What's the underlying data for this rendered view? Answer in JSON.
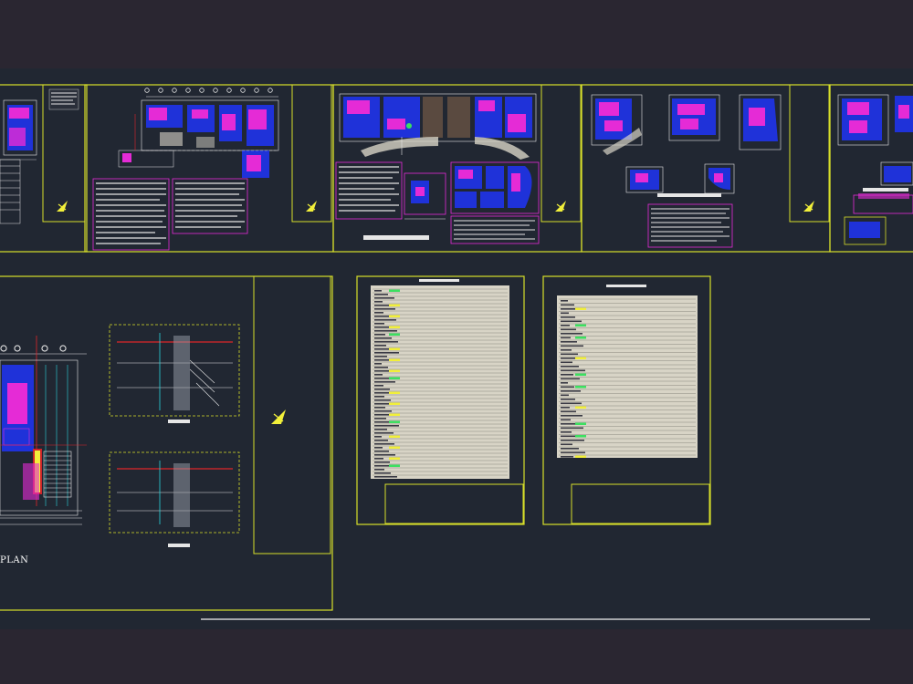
{
  "colors": {
    "bar": "#2a2631",
    "canvas": "#212732",
    "frame": "#d8df2a",
    "magenta": "#e52bd6",
    "blue": "#1f32d9",
    "cyan": "#2ad6dd",
    "red": "#e0252a",
    "white": "#e6e6e6",
    "yellow_fill": "#f2f03a",
    "green": "#3ce060",
    "sheet_paper": "#d8d4c6",
    "stair": "#9aa0aa"
  },
  "drawing": {
    "plan_label": "PLAN"
  },
  "icons": {
    "north_arrow": "north-arrow-icon"
  }
}
